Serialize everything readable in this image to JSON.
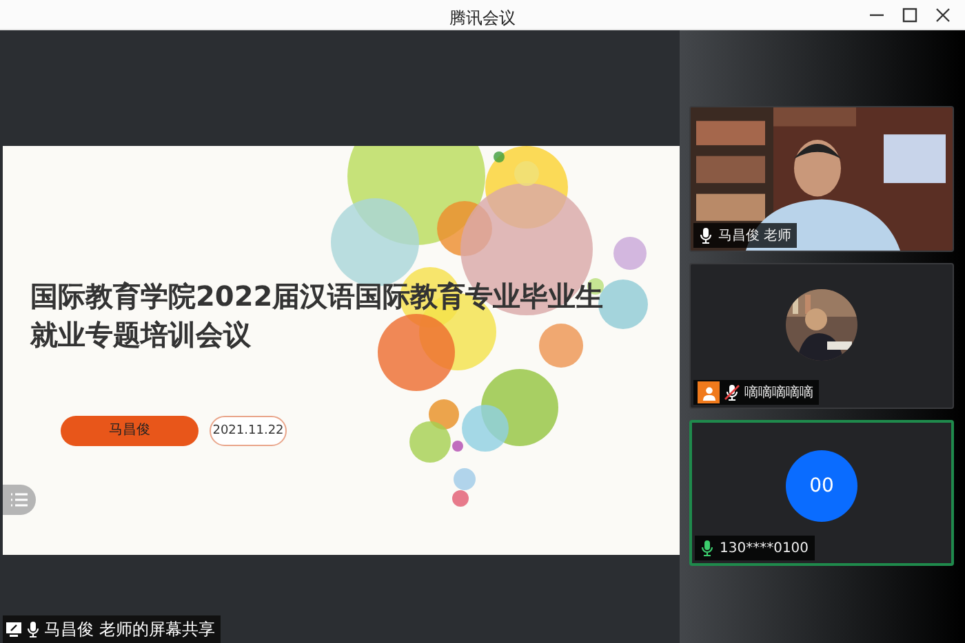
{
  "window": {
    "title": "腾讯会议"
  },
  "slide": {
    "title_lines": [
      "国际教育学院2022届汉语国际教育专业毕业生",
      "就业专题培训会议"
    ],
    "presenter": "马昌俊",
    "date": "2021.11.22"
  },
  "share_label": "马昌俊 老师的屏幕共享",
  "participants": [
    {
      "kind": "video",
      "name": "马昌俊 老师",
      "muted": false,
      "speaking": false,
      "user_badge": false
    },
    {
      "kind": "avatar",
      "name": "嘀嘀嘀嘀嘀",
      "muted": true,
      "speaking": false,
      "user_badge": true
    },
    {
      "kind": "initials",
      "initials": "00",
      "name": "130****0100",
      "muted": false,
      "speaking": true,
      "user_badge": false
    }
  ]
}
